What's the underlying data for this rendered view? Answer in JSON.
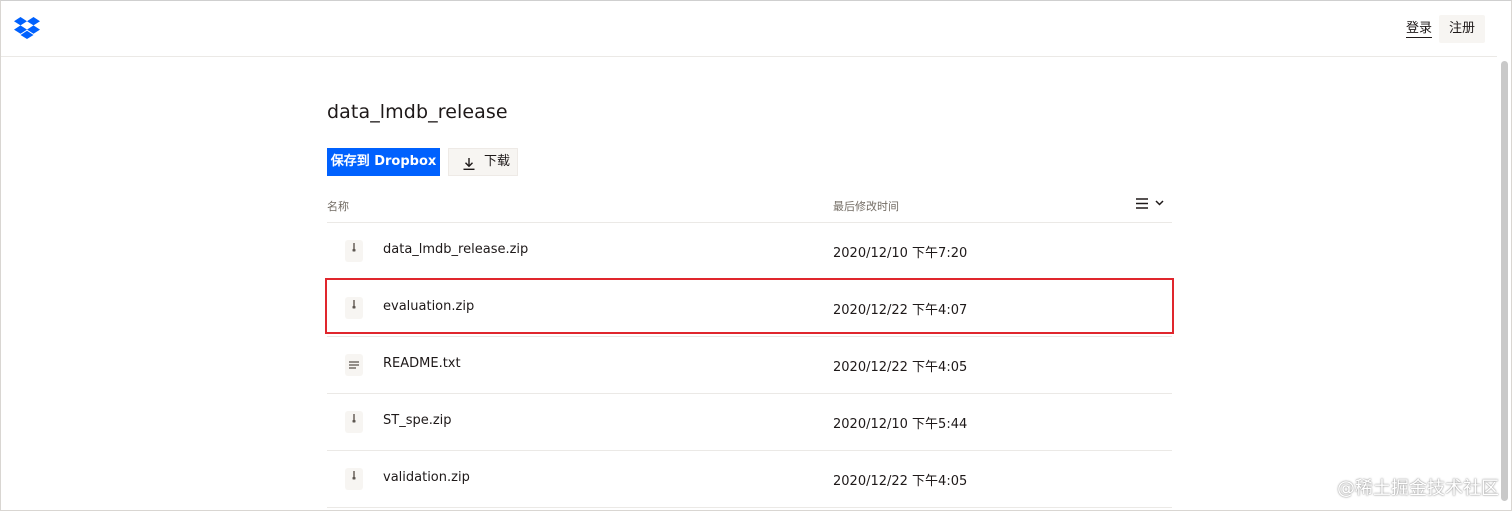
{
  "header": {
    "logo_icon": "dropbox-logo-icon",
    "login_label": "登录",
    "signup_label": "注册"
  },
  "folder": {
    "title": "data_lmdb_release"
  },
  "actions": {
    "save_label": "保存到 Dropbox",
    "download_label": "下载",
    "download_icon": "download-icon"
  },
  "table": {
    "columns": {
      "name": "名称",
      "modified": "最后修改时间"
    },
    "view_toggle_icon": "list-view-icon",
    "rows": [
      {
        "name": "data_lmdb_release.zip",
        "modified": "2020/12/10 下午7:20",
        "icon": "zip-file-icon"
      },
      {
        "name": "evaluation.zip",
        "modified": "2020/12/22 下午4:07",
        "icon": "zip-file-icon"
      },
      {
        "name": "README.txt",
        "modified": "2020/12/22 下午4:05",
        "icon": "text-file-icon"
      },
      {
        "name": "ST_spe.zip",
        "modified": "2020/12/10 下午5:44",
        "icon": "zip-file-icon"
      },
      {
        "name": "validation.zip",
        "modified": "2020/12/22 下午4:05",
        "icon": "zip-file-icon"
      }
    ]
  },
  "annotation": {
    "highlight_color": "#e0262d",
    "highlighted_row": "evaluation.zip"
  },
  "watermark": {
    "text": "@稀土掘金技术社区"
  },
  "colors": {
    "accent": "#0061fe",
    "border": "#ebe9e6",
    "muted_text": "#736c64"
  }
}
